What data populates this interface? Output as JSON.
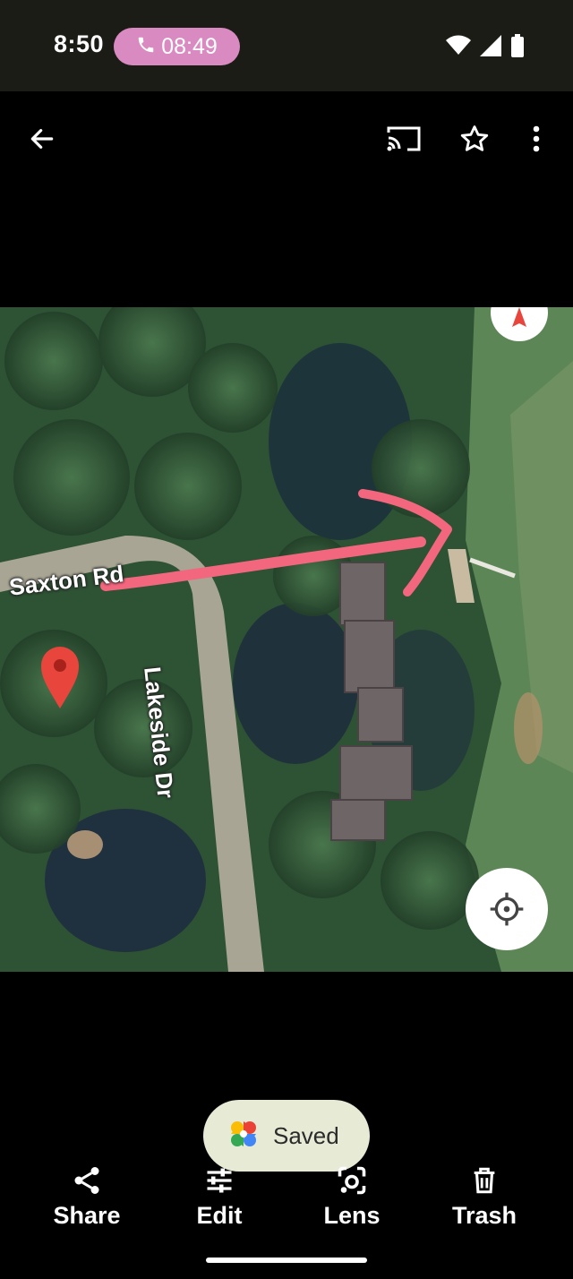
{
  "status_bar": {
    "time": "8:50",
    "call_timer": "08:49",
    "icons": [
      "wifi-icon",
      "signal-icon",
      "battery-icon"
    ]
  },
  "app_bar": {
    "icons": [
      "back-arrow-icon",
      "cast-icon",
      "star-icon",
      "more-vert-icon"
    ]
  },
  "photo": {
    "description_labels": {
      "road_1": "Saxton Rd",
      "road_2": "Lakeside Dr"
    },
    "colors": {
      "pin": "#e8453c",
      "arrow": "#f2667e"
    }
  },
  "toast": {
    "text": "Saved"
  },
  "actions": [
    {
      "label": "Share",
      "icon": "share-icon"
    },
    {
      "label": "Edit",
      "icon": "edit-sliders-icon"
    },
    {
      "label": "Lens",
      "icon": "lens-icon"
    },
    {
      "label": "Trash",
      "icon": "trash-icon"
    }
  ]
}
